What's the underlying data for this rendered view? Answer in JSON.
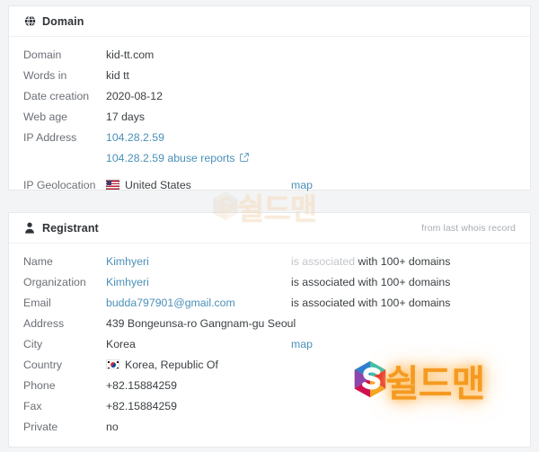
{
  "domain_card": {
    "icon": "globe-icon",
    "title": "Domain",
    "rows": [
      {
        "label": "Domain",
        "value": "kid-tt.com",
        "kind": "text"
      },
      {
        "label": "Words in",
        "value": "kid tt",
        "kind": "text"
      },
      {
        "label": "Date creation",
        "value": "2020-08-12",
        "kind": "text"
      },
      {
        "label": "Web age",
        "value": "17 days",
        "kind": "text"
      }
    ],
    "ip_label": "IP Address",
    "ip_value": "104.28.2.59",
    "ip_abuse_link": "104.28.2.59 abuse reports",
    "ip_abuse_icon": "external-link-icon",
    "geo_label": "IP Geolocation",
    "geo_value": "United States",
    "geo_flag": "flag-united-states-icon",
    "geo_map_link": "map"
  },
  "registrant_card": {
    "icon": "person-icon",
    "title": "Registrant",
    "note": "from last whois record",
    "assoc_prefix": "is associated",
    "assoc_suffix": "with 100+ domains",
    "rows": [
      {
        "label": "Name",
        "value": "Kimhyeri",
        "kind": "link",
        "assoc": true
      },
      {
        "label": "Organization",
        "value": "Kimhyeri",
        "kind": "link",
        "assoc": true
      },
      {
        "label": "Email",
        "value": "budda797901@gmail.com",
        "kind": "link",
        "assoc": true
      },
      {
        "label": "Address",
        "value": "439 Bongeunsa-ro Gangnam-gu Seoul",
        "kind": "text",
        "assoc": false
      },
      {
        "label": "City",
        "value": "Korea",
        "kind": "text",
        "assoc": false,
        "map": "map"
      },
      {
        "label": "Country",
        "value": "Korea, Republic Of",
        "kind": "flag",
        "assoc": false,
        "flag": "flag-korea-icon"
      },
      {
        "label": "Phone",
        "value": "+82.15884259",
        "kind": "text",
        "assoc": false
      },
      {
        "label": "Fax",
        "value": "+82.15884259",
        "kind": "text",
        "assoc": false
      },
      {
        "label": "Private",
        "value": "no",
        "kind": "text",
        "assoc": false
      }
    ]
  },
  "watermarks": {
    "faded": {
      "text": "쉴드맨",
      "logo": "shieldman-s-logo-icon",
      "color": "#f3d9b8"
    },
    "bright": {
      "text": "쉴드맨",
      "logo": "shieldman-s-logo-icon",
      "color": "#f59a21"
    }
  },
  "colors": {
    "link": "#4a90b8",
    "label": "#6b6f76",
    "value": "#3c4043",
    "muted": "#c3c6ca",
    "page_bg": "#f3f4f5",
    "card_bg": "#ffffff"
  }
}
